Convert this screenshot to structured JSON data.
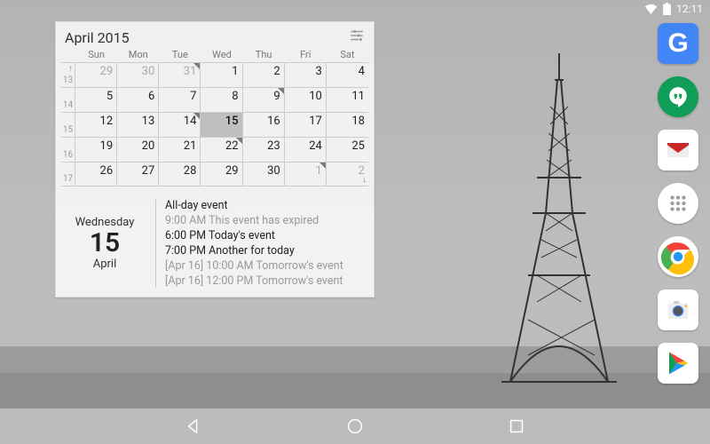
{
  "status": {
    "time": "12:11"
  },
  "dock": [
    {
      "name": "google-search",
      "letter": "G"
    },
    {
      "name": "hangouts"
    },
    {
      "name": "gmail"
    },
    {
      "name": "apps-drawer"
    },
    {
      "name": "chrome"
    },
    {
      "name": "camera"
    },
    {
      "name": "play-store"
    }
  ],
  "widget": {
    "title": "April 2015",
    "days_of_week": [
      "Sun",
      "Mon",
      "Tue",
      "Wed",
      "Thu",
      "Fri",
      "Sat"
    ],
    "weeks": [
      {
        "wk": "13",
        "days": [
          {
            "n": "29",
            "other": true
          },
          {
            "n": "30",
            "other": true
          },
          {
            "n": "31",
            "other": true,
            "marker": true
          },
          {
            "n": "1"
          },
          {
            "n": "2"
          },
          {
            "n": "3"
          },
          {
            "n": "4"
          }
        ]
      },
      {
        "wk": "14",
        "days": [
          {
            "n": "5"
          },
          {
            "n": "6"
          },
          {
            "n": "7"
          },
          {
            "n": "8"
          },
          {
            "n": "9",
            "marker": true
          },
          {
            "n": "10"
          },
          {
            "n": "11"
          }
        ]
      },
      {
        "wk": "15",
        "days": [
          {
            "n": "12"
          },
          {
            "n": "13"
          },
          {
            "n": "14",
            "marker": true
          },
          {
            "n": "15",
            "today": true
          },
          {
            "n": "16"
          },
          {
            "n": "17"
          },
          {
            "n": "18"
          }
        ]
      },
      {
        "wk": "16",
        "days": [
          {
            "n": "19"
          },
          {
            "n": "20"
          },
          {
            "n": "21"
          },
          {
            "n": "22",
            "marker": true
          },
          {
            "n": "23"
          },
          {
            "n": "24"
          },
          {
            "n": "25"
          }
        ]
      },
      {
        "wk": "17",
        "days": [
          {
            "n": "26"
          },
          {
            "n": "27"
          },
          {
            "n": "28"
          },
          {
            "n": "29"
          },
          {
            "n": "30"
          },
          {
            "n": "1",
            "other": true,
            "marker": true
          },
          {
            "n": "2",
            "other": true
          }
        ]
      }
    ],
    "agenda": {
      "dow": "Wednesday",
      "num": "15",
      "month": "April",
      "events": [
        {
          "text": "All-day event",
          "muted": false
        },
        {
          "text": "9:00 AM This event has expired",
          "muted": true
        },
        {
          "text": "6:00 PM Today's event",
          "muted": false
        },
        {
          "text": "7:00 PM Another for today",
          "muted": false
        },
        {
          "text": "[Apr 16] 10:00 AM Tomorrow's event",
          "muted": true
        },
        {
          "text": "[Apr 16] 12:00 PM Tomorrow's event",
          "muted": true
        }
      ]
    }
  }
}
